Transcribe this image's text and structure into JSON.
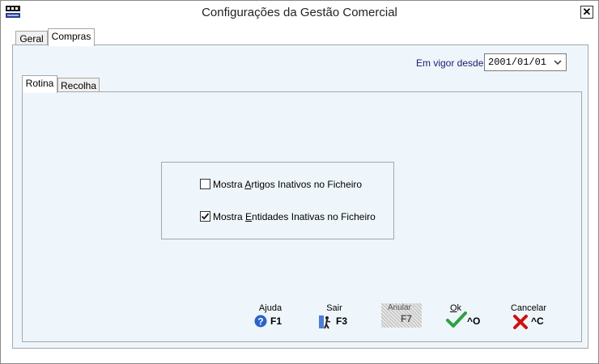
{
  "window": {
    "title": "Configurações da Gestão Comercial",
    "close_glyph": "✕"
  },
  "tabs_outer": [
    {
      "label": "Geral"
    },
    {
      "label": "Compras"
    }
  ],
  "vigor": {
    "label": "Em vigor desde :",
    "value": "2001/01/01"
  },
  "tabs_inner": [
    {
      "label": "Rotina"
    },
    {
      "label": "Recolha"
    }
  ],
  "options": [
    {
      "label_pre": "Mostra ",
      "label_accel": "A",
      "label_post": "rtigos Inativos no Ficheiro",
      "checked": false
    },
    {
      "label_pre": "Mostra ",
      "label_accel": "E",
      "label_post": "ntidades Inativas no Ficheiro",
      "checked": true
    }
  ],
  "buttons": [
    {
      "label": "Ajuda",
      "key": "F1",
      "icon": "help-icon"
    },
    {
      "label": "Sair",
      "key": "F3",
      "icon": "exit-icon"
    },
    {
      "label": "Anular",
      "key": "F7",
      "icon": "disabled-hatch",
      "disabled": true
    },
    {
      "label_pre": "",
      "label_accel": "O",
      "label_post": "k",
      "key": "^O",
      "icon": "check-icon"
    },
    {
      "label": "Cancelar",
      "key": "^C",
      "icon": "x-icon"
    }
  ],
  "colors": {
    "panel_bg": "#eff6fb",
    "label_blue": "#1a1a6e",
    "check_green": "#2ea043",
    "cancel_red": "#d01010",
    "help_blue": "#2a62c9"
  }
}
